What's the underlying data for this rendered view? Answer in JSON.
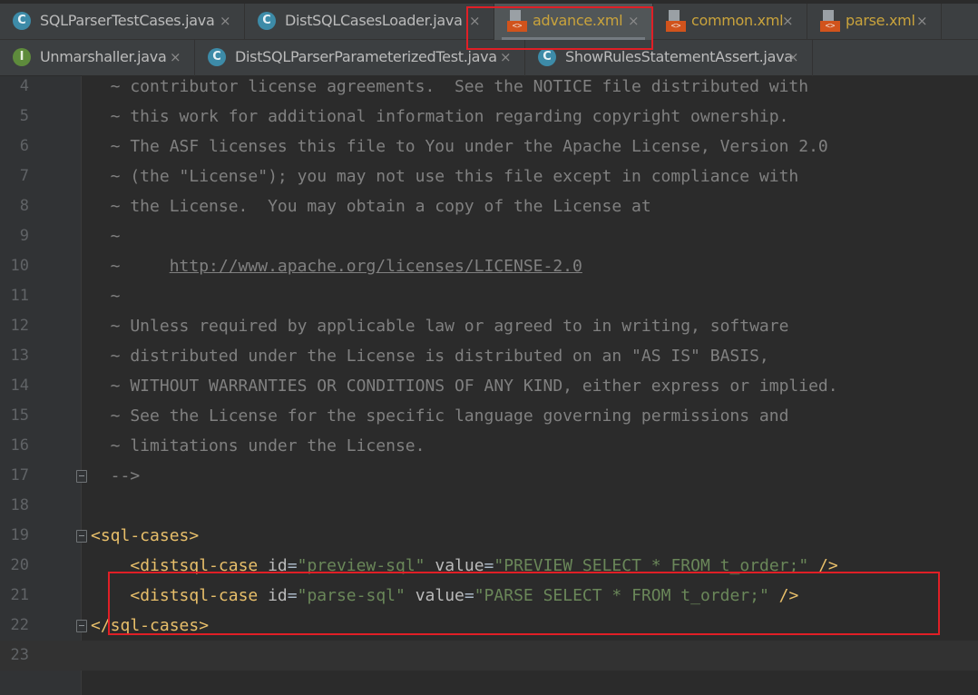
{
  "tabs_row1": [
    {
      "label": "SQLParserTestCases.java",
      "icon": "class-icon",
      "icon_glyph": "C",
      "kind": "java"
    },
    {
      "label": "DistSQLCasesLoader.java",
      "icon": "class-icon",
      "icon_glyph": "C",
      "kind": "java"
    },
    {
      "label": "advance.xml",
      "icon": "xml-file-icon",
      "icon_glyph": "<>",
      "kind": "xml",
      "active": true
    },
    {
      "label": "common.xml",
      "icon": "xml-file-icon",
      "icon_glyph": "<>",
      "kind": "xml"
    },
    {
      "label": "parse.xml",
      "icon": "xml-file-icon",
      "icon_glyph": "<>",
      "kind": "xml"
    }
  ],
  "tabs_row2": [
    {
      "label": "Unmarshaller.java",
      "icon": "interface-icon",
      "icon_glyph": "I",
      "kind": "java"
    },
    {
      "label": "DistSQLParserParameterizedTest.java",
      "icon": "class-icon",
      "icon_glyph": "C",
      "kind": "java"
    },
    {
      "label": "ShowRulesStatementAssert.java",
      "icon": "class-icon",
      "icon_glyph": "C",
      "kind": "java"
    }
  ],
  "close_glyph": "×",
  "colors": {
    "xml_tab_text": "#c9a33c",
    "java_tab_text": "#bbbbbb",
    "highlight": "#e01f26",
    "tag": "#e8bf6a",
    "attr_value": "#6a8759",
    "comment": "#808080"
  },
  "editor": {
    "lines": [
      {
        "n": "4",
        "comment": "  ~ contributor license agreements.  See the NOTICE file distributed with"
      },
      {
        "n": "5",
        "comment": "  ~ this work for additional information regarding copyright ownership."
      },
      {
        "n": "6",
        "comment": "  ~ The ASF licenses this file to You under the Apache License, Version 2.0"
      },
      {
        "n": "7",
        "comment": "  ~ (the \"License\"); you may not use this file except in compliance with"
      },
      {
        "n": "8",
        "comment": "  ~ the License.  You may obtain a copy of the License at"
      },
      {
        "n": "9",
        "comment": "  ~"
      },
      {
        "n": "10",
        "comment": "  ~     ",
        "link": "http://www.apache.org/licenses/LICENSE-2.0"
      },
      {
        "n": "11",
        "comment": "  ~"
      },
      {
        "n": "12",
        "comment": "  ~ Unless required by applicable law or agreed to in writing, software"
      },
      {
        "n": "13",
        "comment": "  ~ distributed under the License is distributed on an \"AS IS\" BASIS,"
      },
      {
        "n": "14",
        "comment": "  ~ WITHOUT WARRANTIES OR CONDITIONS OF ANY KIND, either express or implied."
      },
      {
        "n": "15",
        "comment": "  ~ See the License for the specific language governing permissions and"
      },
      {
        "n": "16",
        "comment": "  ~ limitations under the License."
      },
      {
        "n": "17",
        "comment": "  -->",
        "fold": true
      },
      {
        "n": "18"
      },
      {
        "n": "19",
        "open_tag": "<sql-cases>",
        "fold": true
      },
      {
        "n": "20",
        "indent": "    ",
        "tag": "<distsql-case",
        "a1": "id",
        "v1": "\"preview-sql\"",
        "a2": "value",
        "v2": "\"PREVIEW SELECT * FROM t_order;\"",
        "end": " />"
      },
      {
        "n": "21",
        "indent": "    ",
        "tag": "<distsql-case",
        "a1": "id",
        "v1": "\"parse-sql\"",
        "a2": "value",
        "v2": "\"PARSE SELECT * FROM t_order;\"",
        "end": " />"
      },
      {
        "n": "22",
        "close_tag": "</sql-cases>",
        "fold": true
      },
      {
        "n": "23",
        "caret": true
      }
    ]
  }
}
